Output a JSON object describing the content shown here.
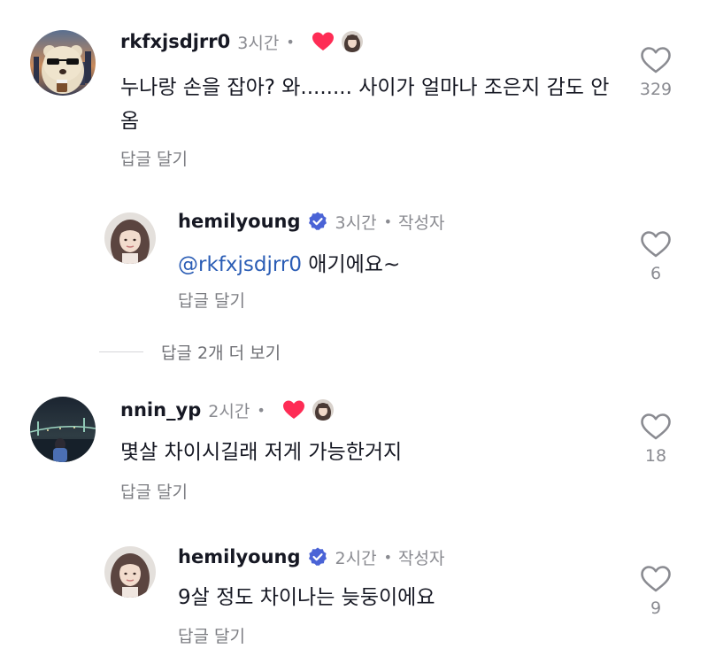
{
  "comments": [
    {
      "username": "rkfxjsdjrr0",
      "time": "3시간",
      "text": "누나랑 손을 잡아? 와........ 사이가 얼마나 조은지 감도 안옴",
      "reply_label": "답글 달기",
      "likes": "329",
      "liked_by_creator": true
    },
    {
      "username": "hemilyoung",
      "verified": true,
      "time": "3시간",
      "author_label": "작성자",
      "mention": "@rkfxjsdjrr0",
      "text": " 애기에요~",
      "reply_label": "답글 달기",
      "likes": "6"
    },
    {
      "username": "nnin_yp",
      "time": "2시간",
      "text": "몇살 차이시길래 저게 가능한거지",
      "reply_label": "답글 달기",
      "likes": "18",
      "liked_by_creator": true
    },
    {
      "username": "hemilyoung",
      "verified": true,
      "time": "2시간",
      "author_label": "작성자",
      "text": "9살 정도 차이나는 늦둥이에요",
      "reply_label": "답글 달기",
      "likes": "9"
    }
  ],
  "more_replies_label": "답글 2개 더 보기",
  "colors": {
    "heart_red": "#fe2c55",
    "verified_blue": "#20d5ec",
    "mention_blue": "#2b5db5",
    "muted_text": "#8a8b91"
  },
  "icons": {
    "like": "heart-outline-icon",
    "creator_liked": "red-heart-icon",
    "verified": "verified-badge-icon"
  }
}
